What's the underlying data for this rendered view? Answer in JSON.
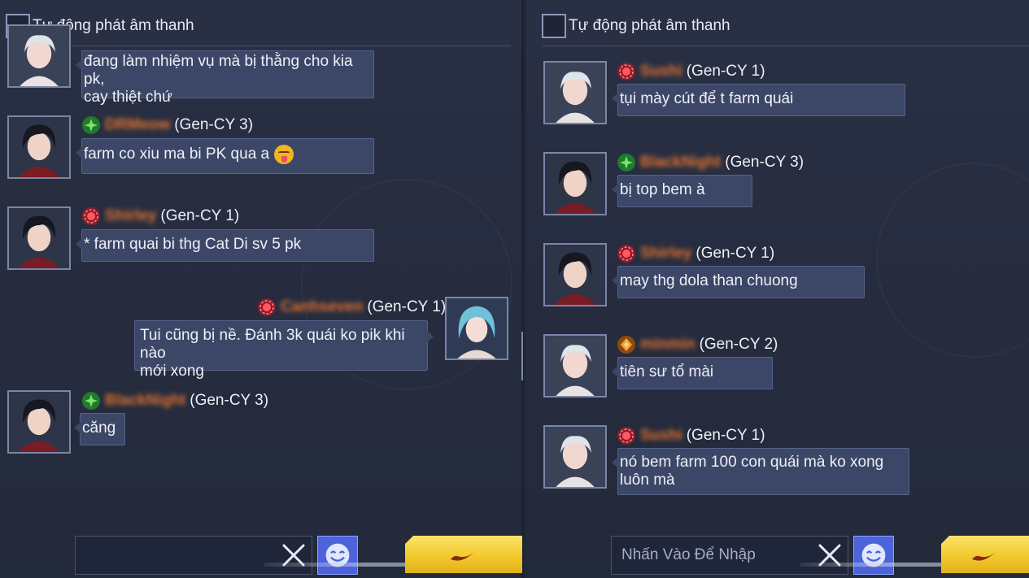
{
  "colors": {
    "background": "#262c3e",
    "bubble": "#3c4767",
    "sender_name": "#e0722f",
    "send_button": "#f2c92d",
    "emoji_button": "#4c63dc"
  },
  "left_panel": {
    "auto_play_label": "Tự động phát âm thanh",
    "messages": [
      {
        "avatar_icon": "silver-hair-avatar-icon",
        "lines": [
          "đang làm nhiệm vụ mà bị thằng cho kia pk,",
          "cay thiệt chứ"
        ]
      },
      {
        "emblem_icon": "green-star-emblem-icon",
        "sender": "DRMeow",
        "server": "(Gen-CY 3)",
        "avatar_icon": "dark-hair-avatar-icon",
        "text": "farm co xiu ma bi PK qua a",
        "emoji_icon": "tongue-out-emoji-icon"
      },
      {
        "emblem_icon": "red-sun-emblem-icon",
        "sender": "Shirley",
        "server": "(Gen-CY 1)",
        "avatar_icon": "dark-hair-avatar-icon",
        "text": "* farm quai bi thg Cat Di sv 5 pk"
      },
      {
        "emblem_icon": "red-sun-emblem-icon",
        "sender": "Canhseven",
        "server": "(Gen-CY 1)",
        "avatar_icon": "blue-hair-girl-avatar-icon",
        "lines": [
          "Tui cũng bị nề. Đánh 3k quái ko pik khi nào",
          "mới xong"
        ]
      },
      {
        "emblem_icon": "green-star-emblem-icon",
        "sender": "BlackNight",
        "server": "(Gen-CY 3)",
        "avatar_icon": "dark-hair-avatar-icon",
        "text": "căng"
      }
    ],
    "input": {
      "value": "",
      "placeholder": ""
    }
  },
  "right_panel": {
    "auto_play_label": "Tự động phát âm thanh",
    "messages": [
      {
        "emblem_icon": "red-sun-emblem-icon",
        "sender": "Sushi",
        "server": "(Gen-CY 1)",
        "avatar_icon": "silver-hair-avatar-icon",
        "text": "tụi mày cút để t farm quái"
      },
      {
        "emblem_icon": "green-star-emblem-icon",
        "sender": "BlackNight",
        "server": "(Gen-CY 3)",
        "avatar_icon": "dark-hair-avatar-icon",
        "text": "bị top bem à"
      },
      {
        "emblem_icon": "red-sun-emblem-icon",
        "sender": "Shirley",
        "server": "(Gen-CY 1)",
        "avatar_icon": "dark-hair-avatar-icon",
        "text": "may thg dola than chuong"
      },
      {
        "emblem_icon": "orange-diamond-emblem-icon",
        "sender": "minmin",
        "server": "(Gen-CY 2)",
        "avatar_icon": "silver-hair-avatar-icon",
        "text": "tiên sư tổ mài"
      },
      {
        "emblem_icon": "red-sun-emblem-icon",
        "sender": "Sushi",
        "server": "(Gen-CY 1)",
        "avatar_icon": "silver-hair-avatar-icon",
        "lines": [
          "nó bem farm 100 con quái mà ko xong",
          "luôn mà"
        ]
      }
    ],
    "input": {
      "value": "",
      "placeholder": "Nhấn Vào Để Nhập"
    }
  }
}
